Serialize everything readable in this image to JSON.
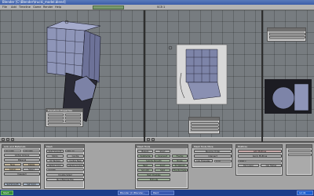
{
  "window": {
    "title": "Blender [C:\\Blender\\trucki_model.blend]"
  },
  "menu": {
    "items": [
      "File",
      "Add",
      "Timeline",
      "Game",
      "Render",
      "Help"
    ],
    "scene_field": "SCE:1"
  },
  "viewports": [
    {
      "name": "left-view"
    },
    {
      "name": "center-view"
    },
    {
      "name": "right-view"
    }
  ],
  "transform_panel": {
    "title": "Transform Properties"
  },
  "buttons_left": {
    "title": "Link and Materials",
    "labels": [
      "ME:Cube",
      "OB:Cube",
      "Vertex Groups",
      "Material",
      "New",
      "Delete",
      "Assign",
      "Select",
      "Deselect",
      "Set Smooth",
      "Set Solid"
    ]
  },
  "buttons_mid": {
    "title": "Mesh",
    "labels": [
      "Auto Smooth",
      "Degr 30",
      "Sticky",
      "UV Texture",
      "Vertex Color",
      "TexMesh",
      "Centre",
      "Centre New",
      "Centre Cursor",
      "Double Sided",
      "No V.Normal Flip"
    ]
  },
  "buttons_tools": {
    "title": "Mesh Tools",
    "labels": [
      "Beauty",
      "Short",
      "Subdivide",
      "Innervert",
      "Fractal",
      "Subdiv Smooth",
      "Noise",
      "Hash",
      "Xsort",
      "To Sphere",
      "Smooth",
      "Split",
      "Flip Normals",
      "Rem Doubles",
      "Extrude"
    ]
  },
  "buttons_tools_more": {
    "title": "Mesh Tools More",
    "labels": [
      "Reverse Order",
      "Intersect",
      "Join Triangles",
      "Limit"
    ]
  },
  "buttons_right": {
    "title": "Multires",
    "labels": [
      "Add Multires",
      "Apply Multires",
      "Level 1",
      "Del Lower",
      "Del Higher"
    ]
  },
  "taskbar": {
    "start": "Start",
    "tasks": [
      "Blender [C:\\Blender...",
      "Paint"
    ],
    "clock": "12:41"
  }
}
